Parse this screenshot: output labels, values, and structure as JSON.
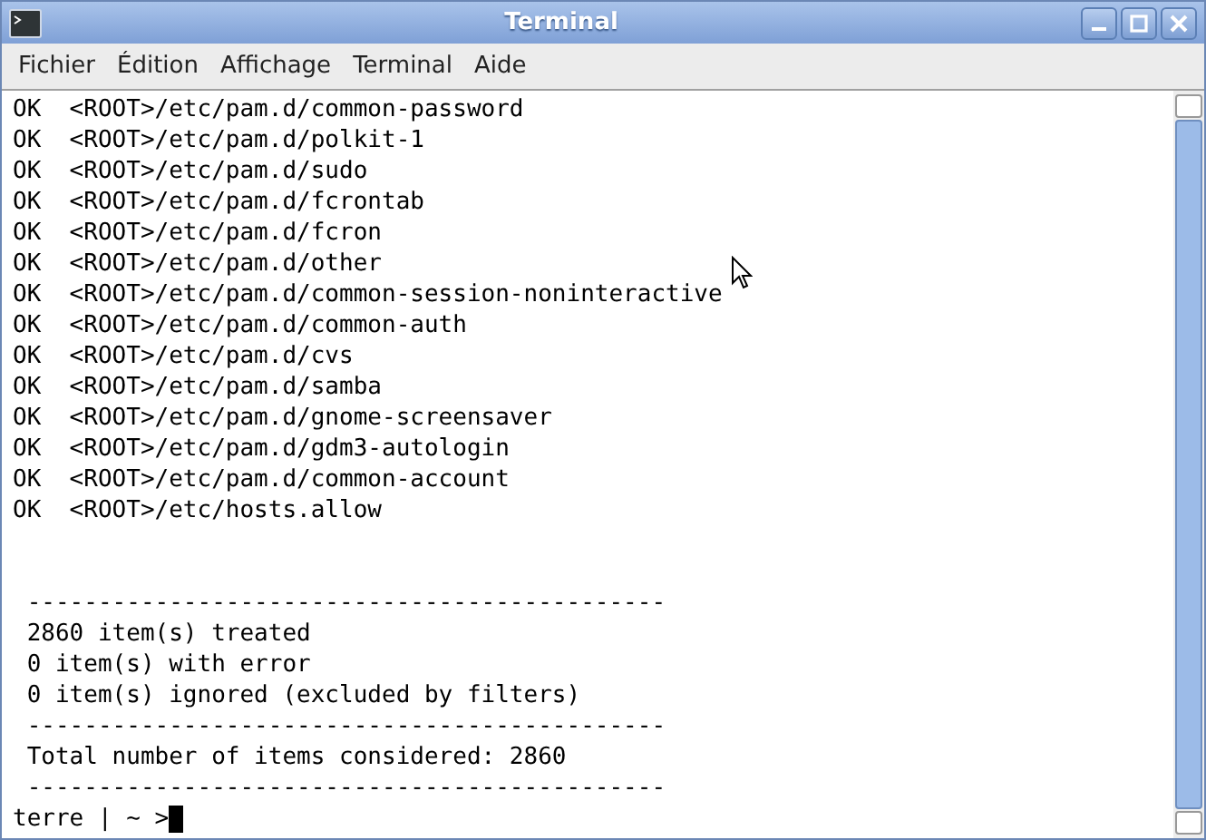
{
  "window": {
    "title": "Terminal"
  },
  "menu": [
    "Fichier",
    "Édition",
    "Affichage",
    "Terminal",
    "Aide"
  ],
  "lines": [
    "OK  <ROOT>/etc/pam.d/common-password",
    "OK  <ROOT>/etc/pam.d/polkit-1",
    "OK  <ROOT>/etc/pam.d/sudo",
    "OK  <ROOT>/etc/pam.d/fcrontab",
    "OK  <ROOT>/etc/pam.d/fcron",
    "OK  <ROOT>/etc/pam.d/other",
    "OK  <ROOT>/etc/pam.d/common-session-noninteractive",
    "OK  <ROOT>/etc/pam.d/common-auth",
    "OK  <ROOT>/etc/pam.d/cvs",
    "OK  <ROOT>/etc/pam.d/samba",
    "OK  <ROOT>/etc/pam.d/gnome-screensaver",
    "OK  <ROOT>/etc/pam.d/gdm3-autologin",
    "OK  <ROOT>/etc/pam.d/common-account",
    "OK  <ROOT>/etc/hosts.allow",
    {
      "kind": "blank"
    },
    {
      "kind": "blank"
    },
    " ---------------------------------------------",
    " 2860 item(s) treated",
    " 0 item(s) with error",
    " 0 item(s) ignored (excluded by filters)",
    " ---------------------------------------------",
    " Total number of items considered: 2860",
    " ---------------------------------------------"
  ],
  "prompt": "terre | ~ >"
}
